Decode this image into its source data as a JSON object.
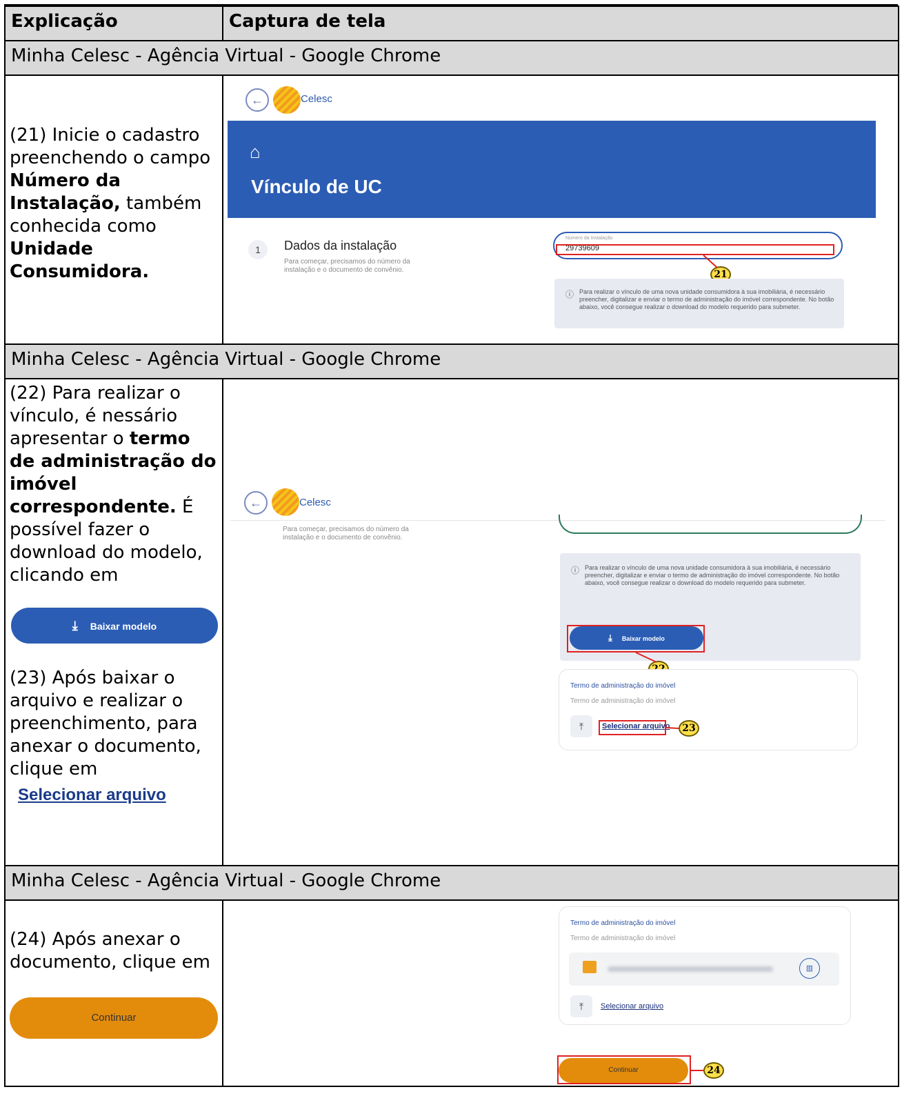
{
  "header": {
    "col1": "Explicação",
    "col2": "Captura de tela"
  },
  "window_title": "Minha Celesc - Agência Virtual - Google Chrome",
  "step21": {
    "pre": "(21) Inicie o cadastro preenchendo o campo ",
    "b1": "Número da Instalação,",
    "mid": " também conhecida como ",
    "b2": "Unidade Consumidora."
  },
  "step22": {
    "pre": "(22) Para realizar o vínculo, é nessário apresentar o ",
    "b1": "termo de administração do imóvel correspondente.",
    "post": " É possível fazer o download do modelo, clicando em",
    "button": "Baixar modelo"
  },
  "step23": {
    "text": "(23) Após baixar o arquivo e realizar o preenchimento, para anexar o documento, clique em",
    "link": "Selecionar arquivo"
  },
  "step24": {
    "text": "(24) Após anexar o documento,  clique em",
    "button": "Continuar"
  },
  "app": {
    "brand": "Celesc",
    "page_title": "Vínculo de UC",
    "step_number": "1",
    "step_title": "Dados da instalação",
    "step_sub": "Para começar, precisamos do número da instalação e o documento de convênio.",
    "input_label": "Número da Instalação",
    "input_value": "29739609",
    "info": "Para realizar o vínculo de uma nova unidade consumidora à sua imobiliária, é necessário preencher, digitalizar e enviar o termo de administração do imóvel correspondente. No botão abaixo, você consegue realizar o download do modelo requerido para submeter.",
    "download_button": "Baixar modelo",
    "card_title": "Termo de administração do imóvel",
    "card_sub": "Termo de administração do imóvel",
    "select_file": "Selecionar arquivo",
    "continue_button": "Continuar"
  },
  "callouts": {
    "c21": "21",
    "c22": "22",
    "c23": "23",
    "c24": "24"
  },
  "colors": {
    "primary_blue": "#2c5db4",
    "continue_orange": "#e38c0b",
    "callout_yellow": "#ffe04a",
    "header_grey": "#d9d9d9",
    "highlight_red": "#e02020"
  }
}
